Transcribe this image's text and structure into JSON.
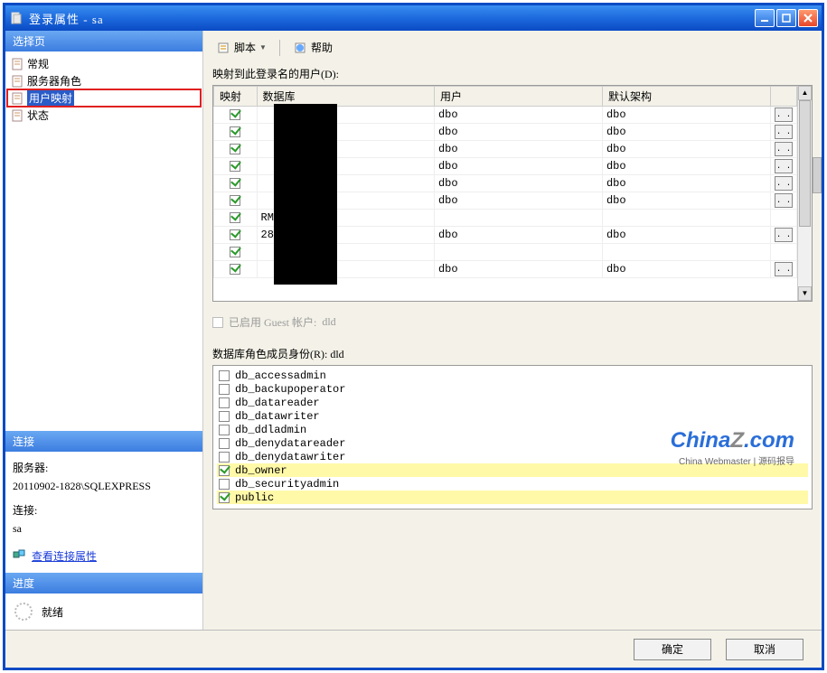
{
  "window": {
    "title": "登录属性 - sa"
  },
  "sidebar": {
    "header": "选择页",
    "items": [
      {
        "label": "常规"
      },
      {
        "label": "服务器角色"
      },
      {
        "label": "用户映射"
      },
      {
        "label": "状态"
      }
    ],
    "selected_index": 2
  },
  "connection": {
    "header": "连接",
    "server_label": "服务器:",
    "server_value": "20110902-1828\\SQLEXPRESS",
    "conn_label": "连接:",
    "conn_value": "sa",
    "view_props": "查看连接属性"
  },
  "progress": {
    "header": "进度",
    "status": "就绪"
  },
  "toolbar": {
    "script": "脚本",
    "help": "帮助"
  },
  "mapping": {
    "label": "映射到此登录名的用户(D):",
    "columns": {
      "map": "映射",
      "db": "数据库",
      "user": "用户",
      "schema": "默认架构"
    },
    "rows": [
      {
        "checked": true,
        "db": "",
        "user": "dbo",
        "schema": "dbo",
        "btn": true
      },
      {
        "checked": true,
        "db": "",
        "user": "dbo",
        "schema": "dbo",
        "btn": true
      },
      {
        "checked": true,
        "db": "",
        "user": "dbo",
        "schema": "dbo",
        "btn": true
      },
      {
        "checked": true,
        "db": "",
        "user": "dbo",
        "schema": "dbo",
        "btn": true
      },
      {
        "checked": true,
        "db": "",
        "user": "dbo",
        "schema": "dbo",
        "btn": true
      },
      {
        "checked": true,
        "db": "",
        "user": "dbo",
        "schema": "dbo",
        "btn": true
      },
      {
        "checked": true,
        "db": "RM",
        "user": "",
        "schema": "",
        "btn": false
      },
      {
        "checked": true,
        "db": "28",
        "user": "dbo",
        "schema": "dbo",
        "btn": true
      },
      {
        "checked": true,
        "db": "",
        "user": "",
        "schema": "",
        "btn": false
      },
      {
        "checked": true,
        "db": "",
        "user": "dbo",
        "schema": "dbo",
        "btn": true
      }
    ]
  },
  "guest": {
    "label": "已启用 Guest 帐户:",
    "value": "dld"
  },
  "roles": {
    "label": "数据库角色成员身份(R): dld",
    "items": [
      {
        "name": "db_accessadmin",
        "checked": false,
        "hl": false
      },
      {
        "name": "db_backupoperator",
        "checked": false,
        "hl": false
      },
      {
        "name": "db_datareader",
        "checked": false,
        "hl": false
      },
      {
        "name": "db_datawriter",
        "checked": false,
        "hl": false
      },
      {
        "name": "db_ddladmin",
        "checked": false,
        "hl": false
      },
      {
        "name": "db_denydatareader",
        "checked": false,
        "hl": false
      },
      {
        "name": "db_denydatawriter",
        "checked": false,
        "hl": false
      },
      {
        "name": "db_owner",
        "checked": true,
        "hl": true
      },
      {
        "name": "db_securityadmin",
        "checked": false,
        "hl": false
      },
      {
        "name": "public",
        "checked": true,
        "hl": true
      }
    ]
  },
  "buttons": {
    "ok": "确定",
    "cancel": "取消"
  },
  "watermark": {
    "line1_a": "China",
    "line1_b": "Z",
    "line1_c": ".com",
    "line2": "China Webmaster | 源码报导"
  }
}
